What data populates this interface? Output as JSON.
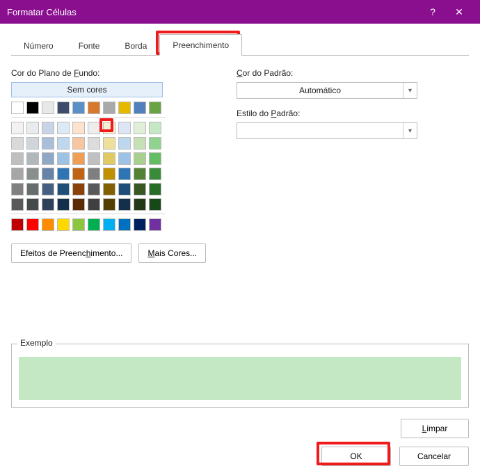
{
  "window": {
    "title": "Formatar Células",
    "help_glyph": "?",
    "close_glyph": "✕"
  },
  "tabs": {
    "items": [
      {
        "label": "Número"
      },
      {
        "label": "Fonte"
      },
      {
        "label": "Borda"
      },
      {
        "label": "Preenchimento"
      }
    ],
    "active_index": 3
  },
  "left": {
    "bg_label_prefix": "Cor do Plano de ",
    "bg_label_mnemonic": "F",
    "bg_label_suffix": "undo:",
    "nocolor_label": "Sem cores",
    "fill_effects_prefix": "Efeitos de Preenc",
    "fill_effects_mnemonic": "h",
    "fill_effects_suffix": "imento...",
    "more_colors_mnemonic": "M",
    "more_colors_suffix": "ais Cores...",
    "palette": {
      "group_a": [
        [
          "#ffffff",
          "#000000",
          "#e8e8e8",
          "#3f4b6b",
          "#5b8fc7",
          "#d7782a",
          "#a9a9a9",
          "#e6b800",
          "#5280bc",
          "#6aa343"
        ],
        [
          "#ffffff",
          "#f2f2f2",
          "#d9d9d9",
          "#bfbfbf",
          "#a6a6a6",
          "#808080",
          "#595959",
          "#404040",
          "#262626",
          "#0d0d0d"
        ]
      ],
      "group_b": [
        [
          "#f2f2f2",
          "#e8ecee",
          "#c8d4e8",
          "#dde9f6",
          "#fde2cd",
          "#ededed",
          "#f6edd2",
          "#dde6f4",
          "#e2efd8",
          "#c4e8c4"
        ],
        [
          "#d9d9d9",
          "#cfd5d8",
          "#a9bed9",
          "#bdd7ee",
          "#f7c59f",
          "#dcdcdc",
          "#eedf9b",
          "#bdd7ee",
          "#c5e0b4",
          "#8fd38f"
        ],
        [
          "#bfbfbf",
          "#b0b8bb",
          "#8fa8c8",
          "#9cc3e6",
          "#ef9e54",
          "#c0c0c0",
          "#e1ca62",
          "#9cc3e6",
          "#a9d08e",
          "#63be63"
        ],
        [
          "#a6a6a6",
          "#87908f",
          "#6684a8",
          "#2e75b6",
          "#c16312",
          "#7f7f7f",
          "#bf9000",
          "#2e75b6",
          "#548235",
          "#3a8b3a"
        ],
        [
          "#808080",
          "#666e6d",
          "#465f80",
          "#1f4e79",
          "#8a4209",
          "#595959",
          "#806000",
          "#1f4e79",
          "#385724",
          "#276d27"
        ],
        [
          "#595959",
          "#444b4a",
          "#2f405a",
          "#132f4b",
          "#5a2b06",
          "#404040",
          "#553f00",
          "#132f4b",
          "#243a17",
          "#174817"
        ]
      ],
      "group_c": [
        [
          "#c00000",
          "#ff0000",
          "#ff8c00",
          "#ffd800",
          "#8cc63f",
          "#00b050",
          "#00b0f0",
          "#0070c0",
          "#002060",
          "#7030a0"
        ]
      ],
      "selected": {
        "group": "b",
        "row": 0,
        "col": 9
      }
    }
  },
  "right": {
    "pattern_color_mnemonic": "C",
    "pattern_color_suffix": "or do Padrão:",
    "pattern_color_value": "Automático",
    "pattern_style_prefix": "Estilo do ",
    "pattern_style_mnemonic": "P",
    "pattern_style_suffix": "adrão:",
    "pattern_style_value": ""
  },
  "example": {
    "legend": "Exemplo",
    "fill_color": "#c4e8c4"
  },
  "buttons": {
    "clear_mnemonic": "L",
    "clear_suffix": "impar",
    "ok": "OK",
    "cancel": "Cancelar"
  }
}
